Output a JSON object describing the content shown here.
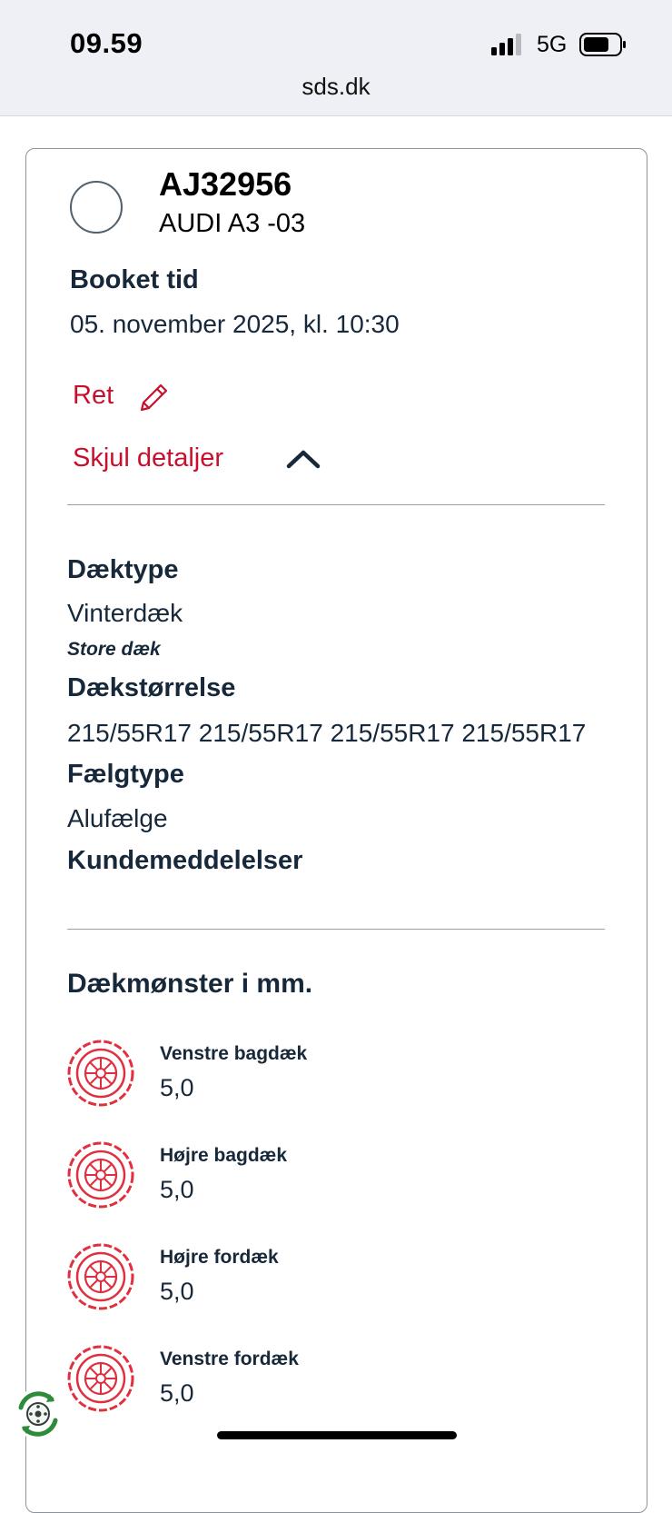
{
  "status_bar": {
    "time": "09.59",
    "network": "5G",
    "url": "sds.dk"
  },
  "booking": {
    "plate": "AJ32956",
    "model": "AUDI A3 -03",
    "booked_label": "Booket tid",
    "booked_value": "05. november 2025, kl. 10:30",
    "edit_label": "Ret",
    "toggle_label": "Skjul detaljer"
  },
  "details": {
    "tire_type_label": "Dæktype",
    "tire_type_value": "Vinterdæk",
    "tire_note": "Store dæk",
    "tire_size_label": "Dækstørrelse",
    "tire_size_value": "215/55R17 215/55R17 215/55R17 215/55R17",
    "rim_type_label": "Fælgtype",
    "rim_type_value": "Alufælge",
    "messages_label": "Kundemeddelelser"
  },
  "tread": {
    "title": "Dækmønster i mm.",
    "tires": [
      {
        "name": "Venstre bagdæk",
        "depth": "5,0"
      },
      {
        "name": "Højre bagdæk",
        "depth": "5,0"
      },
      {
        "name": "Højre fordæk",
        "depth": "5,0"
      },
      {
        "name": "Venstre fordæk",
        "depth": "5,0"
      }
    ]
  },
  "colors": {
    "accent": "#c8102e",
    "text": "#16283a",
    "fab_green": "#2e8b3a"
  }
}
